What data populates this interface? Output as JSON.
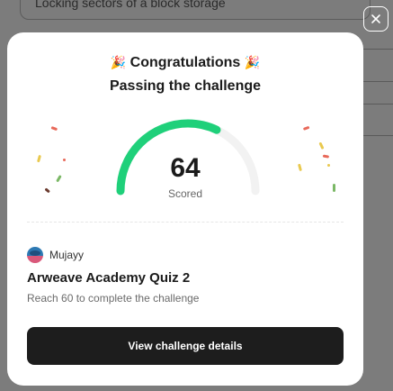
{
  "background": {
    "option_text": "Locking sectors of a block storage"
  },
  "close_icon": "close-icon",
  "modal": {
    "title": "Congratulations",
    "title_emoji_left": "🎉",
    "title_emoji_right": "🎉",
    "subtitle": "Passing the challenge",
    "score": {
      "value": "64",
      "label": "Scored",
      "gauge_percent": 64,
      "gauge_color": "#1fd07a",
      "track_color": "#f2f2f2"
    },
    "user": {
      "avatar_icon": "avatar",
      "name": "Mujayy"
    },
    "quiz_title": "Arweave Academy Quiz 2",
    "quiz_description": "Reach 60 to complete the challenge",
    "button_label": "View challenge details"
  },
  "colors": {
    "button_bg": "#1d1d1d",
    "confetti": [
      "#e8695a",
      "#e9c94f",
      "#7bb866",
      "#6b3b2f"
    ]
  }
}
